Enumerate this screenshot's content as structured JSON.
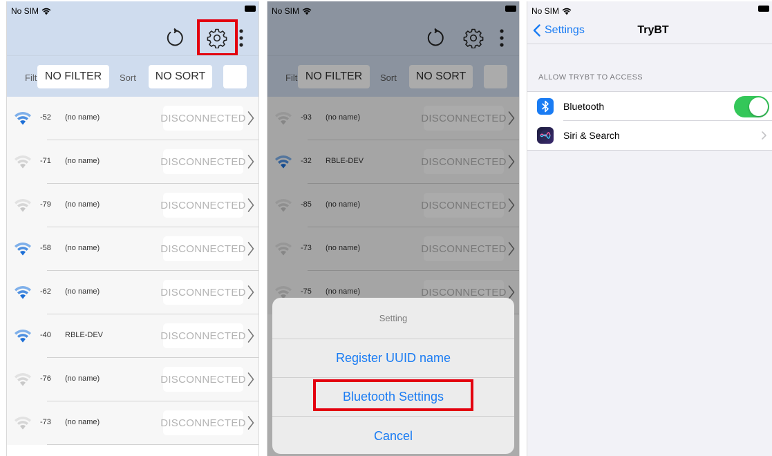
{
  "status": {
    "carrier": "No SIM"
  },
  "toolbar": {
    "refresh_icon": "refresh-icon",
    "settings_icon": "gear-icon",
    "more_icon": "more-vertical-icon"
  },
  "filterbar": {
    "filter_label": "Filte",
    "filter_value": "NO FILTER",
    "sort_label": "Sort",
    "sort_value": "NO SORT"
  },
  "screen1": {
    "devices": [
      {
        "rssi": "-52",
        "name": "(no name)",
        "state": "DISCONNECTED",
        "strong": true
      },
      {
        "rssi": "-71",
        "name": "(no name)",
        "state": "DISCONNECTED",
        "strong": false
      },
      {
        "rssi": "-79",
        "name": "(no name)",
        "state": "DISCONNECTED",
        "strong": false
      },
      {
        "rssi": "-58",
        "name": "(no name)",
        "state": "DISCONNECTED",
        "strong": true
      },
      {
        "rssi": "-62",
        "name": "(no name)",
        "state": "DISCONNECTED",
        "strong": true
      },
      {
        "rssi": "-40",
        "name": "RBLE-DEV",
        "state": "DISCONNECTED",
        "strong": true
      },
      {
        "rssi": "-76",
        "name": "(no name)",
        "state": "DISCONNECTED",
        "strong": false
      },
      {
        "rssi": "-73",
        "name": "(no name)",
        "state": "DISCONNECTED",
        "strong": false
      }
    ]
  },
  "screen2": {
    "devices": [
      {
        "rssi": "-93",
        "name": "(no name)",
        "state": "DISCONNECTED",
        "strong": false
      },
      {
        "rssi": "-32",
        "name": "RBLE-DEV",
        "state": "DISCONNECTED",
        "strong": true
      },
      {
        "rssi": "-85",
        "name": "(no name)",
        "state": "DISCONNECTED",
        "strong": false
      },
      {
        "rssi": "-73",
        "name": "(no name)",
        "state": "DISCONNECTED",
        "strong": false
      },
      {
        "rssi": "-75",
        "name": "(no name)",
        "state": "DISCONNECTED",
        "strong": false
      }
    ],
    "action_sheet": {
      "title": "Setting",
      "register": "Register UUID name",
      "bluetooth": "Bluetooth Settings",
      "cancel": "Cancel"
    }
  },
  "screen3": {
    "back_label": "Settings",
    "title": "TryBT",
    "section_header": "ALLOW TRYBT TO ACCESS",
    "items": [
      {
        "label": "Bluetooth",
        "icon": "bluetooth-icon",
        "toggle_on": true
      },
      {
        "label": "Siri & Search",
        "icon": "siri-icon"
      }
    ]
  },
  "colors": {
    "accent": "#1a7cf3",
    "highlight": "#e3000f",
    "header_bg": "#cfdcee",
    "toggle_on": "#34c759",
    "signal_strong": "#1d6fd6",
    "signal_weak": "#c8c8c8"
  }
}
